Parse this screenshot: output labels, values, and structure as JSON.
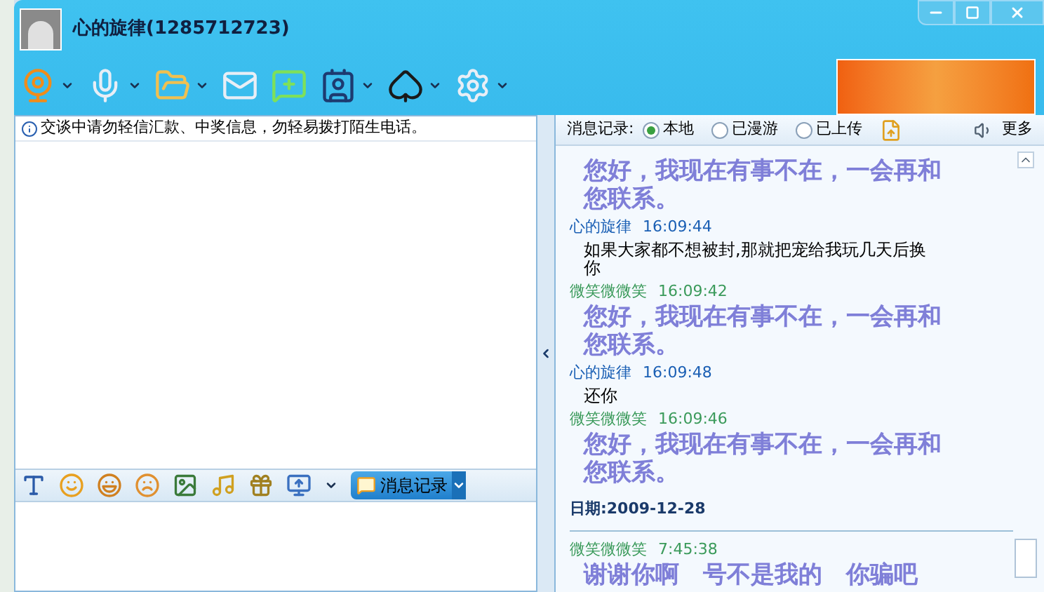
{
  "window": {
    "title": "心的旋律(1285712723)"
  },
  "notice": "交谈中请勿轻信汇款、中奖信息，勿轻易拨打陌生电话。",
  "input_toolbar": {
    "history_button": "消息记录"
  },
  "history": {
    "label": "消息记录:",
    "sources": [
      {
        "label": "本地",
        "selected": true
      },
      {
        "label": "已漫游",
        "selected": false
      },
      {
        "label": "已上传",
        "selected": false
      }
    ],
    "more": "更多"
  },
  "messages": [
    {
      "kind": "auto_reply",
      "text": "您好，我现在有事不在，一会再和您联系。"
    },
    {
      "kind": "message",
      "sender": "心的旋律",
      "time": "16:09:44",
      "color": "#1a5fb4",
      "text": "如果大家都不想被封,那就把宠给我玩几天后换你"
    },
    {
      "kind": "message",
      "sender": "微笑微微笑",
      "time": "16:09:42",
      "color": "#3a9a5a"
    },
    {
      "kind": "auto_reply",
      "text": "您好，我现在有事不在，一会再和您联系。"
    },
    {
      "kind": "message",
      "sender": "心的旋律",
      "time": "16:09:48",
      "color": "#1a5fb4",
      "text": "还你"
    },
    {
      "kind": "message",
      "sender": "微笑微微笑",
      "time": "16:09:46",
      "color": "#3a9a5a"
    },
    {
      "kind": "auto_reply",
      "text": "您好，我现在有事不在，一会再和您联系。"
    },
    {
      "kind": "date",
      "label": "日期:",
      "date": "2009-12-28"
    },
    {
      "kind": "message",
      "sender": "微笑微微笑",
      "time": "7:45:38",
      "color": "#3a9a5a"
    },
    {
      "kind": "auto_reply",
      "text": "谢谢你啊　号不是我的　你骗吧"
    }
  ]
}
